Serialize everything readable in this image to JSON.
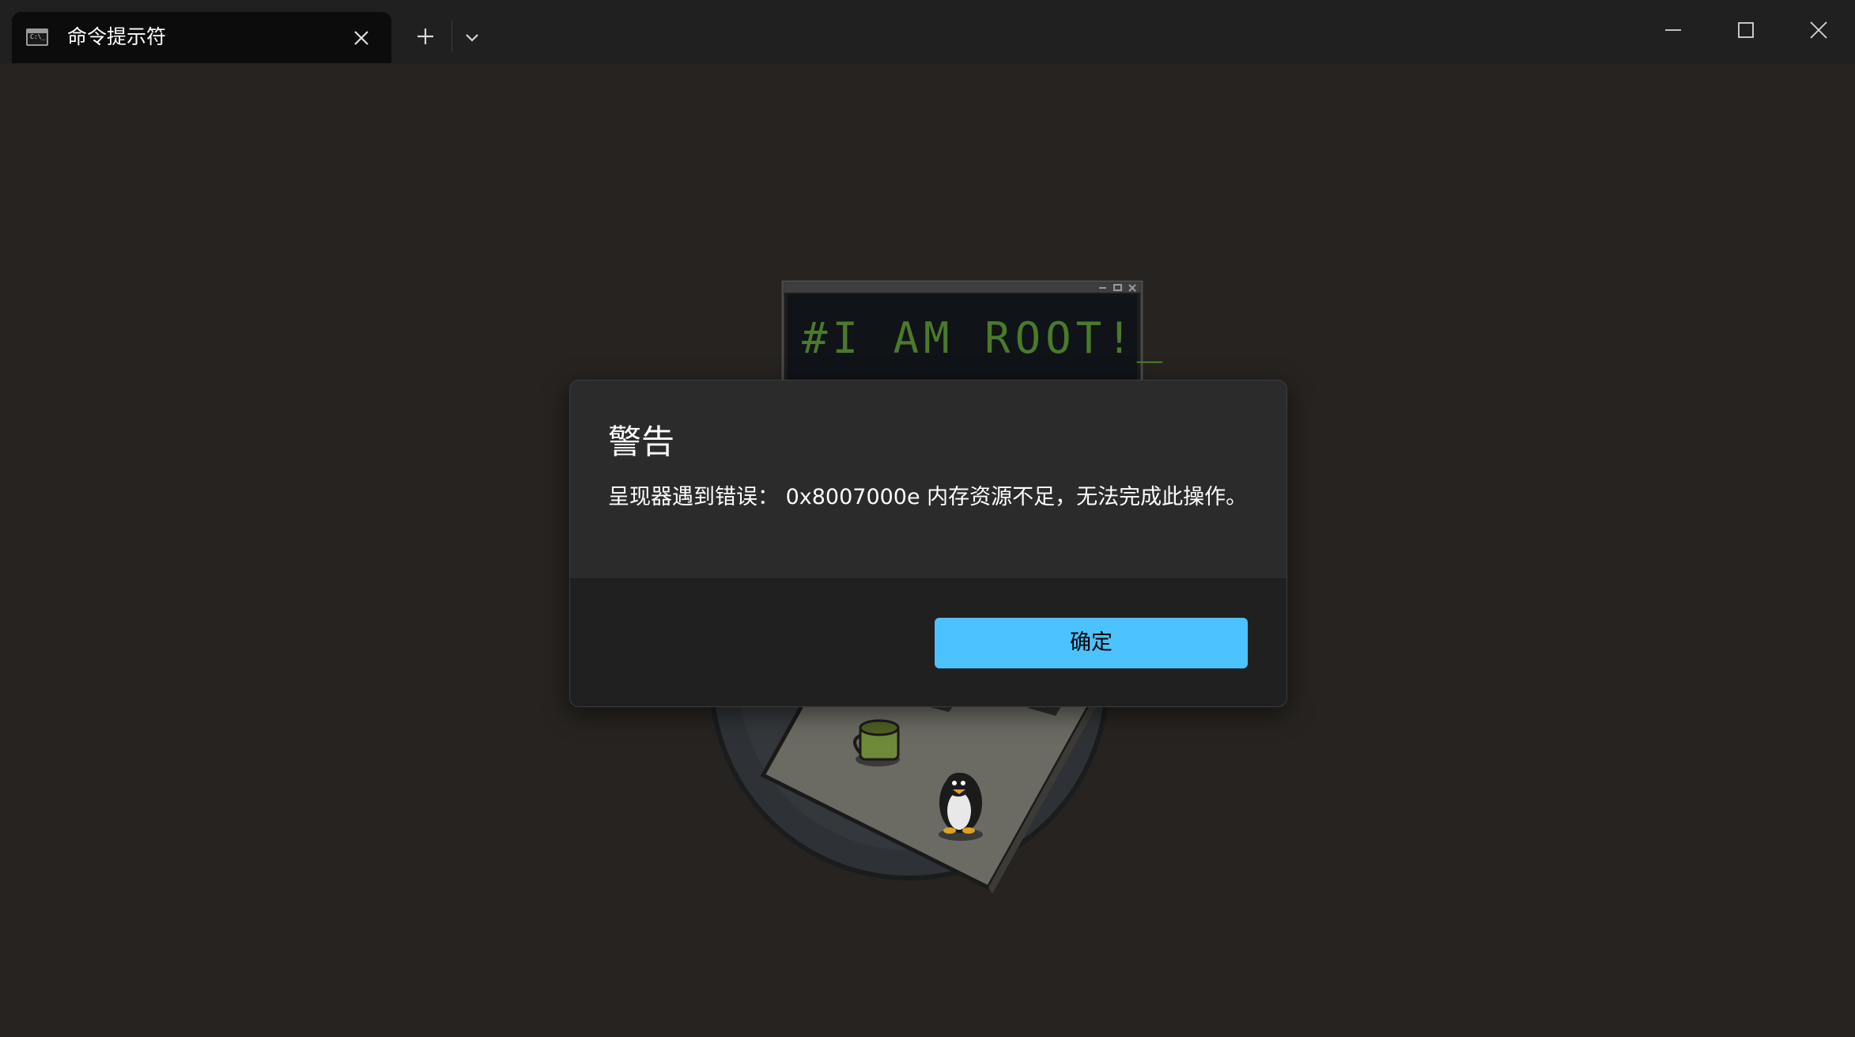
{
  "window": {
    "tab_title": "命令提示符",
    "tab_icon_text": "C:\\_",
    "icons": {
      "tab_icon": "terminal-icon",
      "tab_close": "close-icon",
      "new_tab": "plus-icon",
      "dropdown": "chevron-down-icon",
      "minimize": "minimize-icon",
      "maximize": "maximize-icon",
      "close": "close-icon"
    }
  },
  "illustration": {
    "screen_text": "#I AM ROOT!_"
  },
  "dialog": {
    "title": "警告",
    "message": "呈现器遇到错误： 0x8007000e 内存资源不足，无法完成此操作。",
    "ok_label": "确定"
  },
  "colors": {
    "background": "#262320",
    "titlebar": "#202020",
    "dialog": "#2b2b2b",
    "dialog_footer": "#202020",
    "accent": "#4cc2ff",
    "screen_text": "#4a7a2a"
  }
}
